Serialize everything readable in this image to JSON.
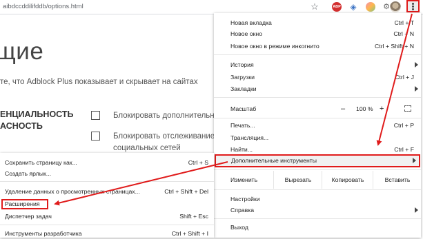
{
  "browser": {
    "url": "aibdccddilifddb/options.html",
    "toolbar_icons": [
      "star-icon",
      "adblock-plus-icon",
      "extension-icon",
      "colorful-extension-icon",
      "extension-gear-icon",
      "avatar",
      "menu-icon"
    ],
    "abp_badge": "ABP"
  },
  "page": {
    "heading": "щие",
    "description": "те, что Adblock Plus показывает и скрывает на сайтах",
    "section_title": "ЕНЦИАЛЬНОСТЬ\nАСНОСТЬ",
    "options": [
      {
        "label": "Блокировать дополнительн"
      },
      {
        "label": "Блокировать отслеживание\nсоциальных сетей"
      }
    ]
  },
  "main_menu": {
    "items": [
      {
        "label": "Новая вкладка",
        "shortcut": "Ctrl + T"
      },
      {
        "label": "Новое окно",
        "shortcut": "Ctrl + N"
      },
      {
        "label": "Новое окно в режиме инкогнито",
        "shortcut": "Ctrl + Shift + N"
      },
      {
        "label": "История",
        "shortcut": ""
      },
      {
        "label": "Загрузки",
        "shortcut": "Ctrl + J"
      },
      {
        "label": "Закладки",
        "shortcut": ""
      },
      {
        "label": "Масштаб",
        "shortcut": ""
      },
      {
        "label": "Печать...",
        "shortcut": "Ctrl + P"
      },
      {
        "label": "Трансляция...",
        "shortcut": ""
      },
      {
        "label": "Найти...",
        "shortcut": "Ctrl + F"
      },
      {
        "label": "Дополнительные инструменты",
        "shortcut": ""
      },
      {
        "label": "Настройки",
        "shortcut": ""
      },
      {
        "label": "Справка",
        "shortcut": ""
      },
      {
        "label": "Выход",
        "shortcut": ""
      }
    ],
    "zoom": {
      "minus": "–",
      "value": "100 %",
      "plus": "+"
    },
    "edit": {
      "label": "Изменить",
      "cut": "Вырезать",
      "copy": "Копировать",
      "paste": "Вставить"
    }
  },
  "sub_menu": {
    "items": [
      {
        "label": "Сохранить страницу как...",
        "shortcut": "Ctrl + S"
      },
      {
        "label": "Создать ярлык...",
        "shortcut": ""
      },
      {
        "label": "Удаление данных о просмотренных страницах...",
        "shortcut": "Ctrl + Shift + Del"
      },
      {
        "label": "Расширения",
        "shortcut": ""
      },
      {
        "label": "Диспетчер задач",
        "shortcut": "Shift + Esc"
      },
      {
        "label": "Инструменты разработчика",
        "shortcut": "Ctrl + Shift + I"
      }
    ]
  },
  "colors": {
    "highlight_red": "#e01b1b",
    "hover_bg": "#f1f1f1"
  }
}
